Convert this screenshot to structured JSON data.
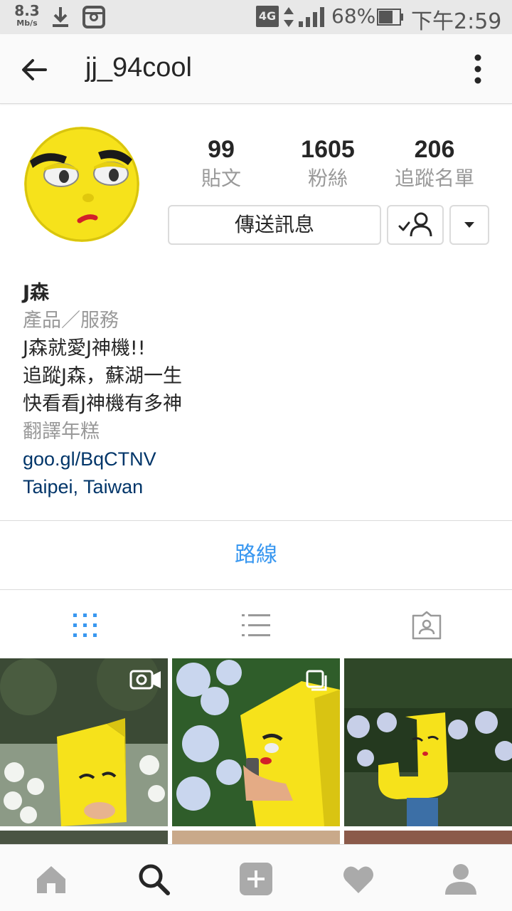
{
  "status_bar": {
    "net_speed_value": "8.3",
    "net_speed_unit": "Mb/s",
    "network_type": "4G",
    "battery_percent": "68%",
    "time": "下午2:59",
    "icons": [
      "download-icon",
      "instagram-notification-icon",
      "data-arrows-icon",
      "signal-icon",
      "battery-icon"
    ]
  },
  "app_bar": {
    "username": "jj_94cool",
    "back_icon": "back-arrow-icon",
    "more_icon": "more-vertical-icon"
  },
  "profile": {
    "stats": [
      {
        "value": "99",
        "label": "貼文"
      },
      {
        "value": "1605",
        "label": "粉絲"
      },
      {
        "value": "206",
        "label": "追蹤名單"
      }
    ],
    "message_button": "傳送訊息",
    "follow_icon": "following-check-icon",
    "dropdown_icon": "caret-down-icon"
  },
  "bio": {
    "name": "J森",
    "category": "產品／服務",
    "lines": [
      "J森就愛J神機!!",
      "追蹤J森，蘇湖一生",
      "快看看J神機有多神"
    ],
    "translate": "翻譯年糕",
    "link": "goo.gl/BqCTNV",
    "location": "Taipei, Taiwan"
  },
  "directions_label": "路線",
  "tabs": [
    {
      "icon": "grid-icon",
      "active": true
    },
    {
      "icon": "list-icon",
      "active": false
    },
    {
      "icon": "tagged-icon",
      "active": false
    }
  ],
  "grid": [
    {
      "badge": "video-icon"
    },
    {
      "badge": "carousel-icon"
    },
    {
      "badge": ""
    }
  ],
  "bottom_nav": [
    {
      "icon": "home-icon",
      "active": false
    },
    {
      "icon": "search-icon",
      "active": true
    },
    {
      "icon": "add-post-icon",
      "active": false
    },
    {
      "icon": "heart-icon",
      "active": false
    },
    {
      "icon": "profile-icon",
      "active": false
    }
  ],
  "colors": {
    "link_blue": "#3897f0",
    "bio_link": "#003569",
    "secondary_text": "#999999",
    "border": "#dbdbdb",
    "avatar_yellow": "#f6e21b"
  }
}
